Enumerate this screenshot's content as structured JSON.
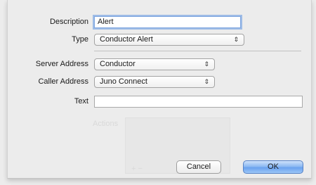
{
  "form": {
    "description": {
      "label": "Description",
      "value": "Alert"
    },
    "type": {
      "label": "Type",
      "value": "Conductor Alert"
    },
    "server_address": {
      "label": "Server Address",
      "value": "Conductor"
    },
    "caller_address": {
      "label": "Caller Address",
      "value": "Juno Connect"
    },
    "text": {
      "label": "Text",
      "value": ""
    }
  },
  "buttons": {
    "cancel": "Cancel",
    "ok": "OK"
  },
  "background": {
    "actions_label": "Actions"
  },
  "icons": {
    "popup_arrows": "up-down-chevron-icon"
  },
  "colors": {
    "focus_ring": "#5e96e1",
    "primary_button": "#6aa2ee"
  }
}
